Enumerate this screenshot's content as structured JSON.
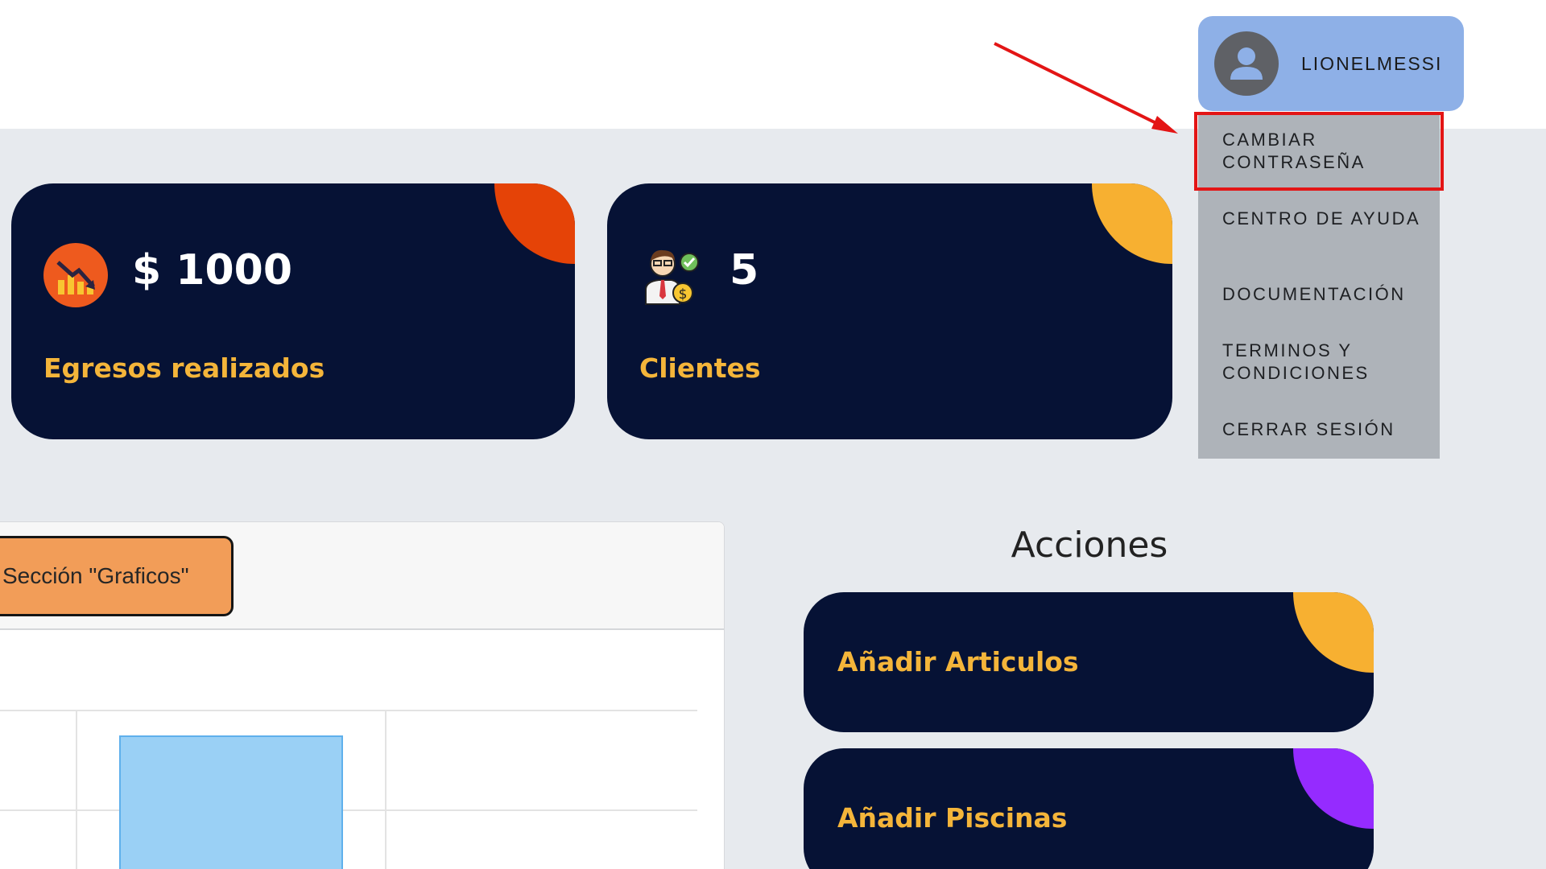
{
  "header": {
    "user_name": "LIONELMESSI"
  },
  "user_menu": {
    "items": [
      {
        "label": "CAMBIAR CONTRASEÑA",
        "highlighted": true
      },
      {
        "label": "CENTRO DE AYUDA"
      },
      {
        "label": "DOCUMENTACIÓN"
      },
      {
        "label": "TERMINOS Y CONDICIONES"
      },
      {
        "label": "CERRAR SESIÓN"
      }
    ]
  },
  "stats": [
    {
      "value": "$ 1000",
      "label": "Egresos realizados",
      "icon": "expenses-chart-icon",
      "accent": "#e54307"
    },
    {
      "value": "5",
      "label": "Clientes",
      "icon": "client-money-icon",
      "accent": "#f7b031"
    }
  ],
  "graphs_section": {
    "button_label": "Sección \"Graficos\"",
    "bar_color": "#9ad0f5"
  },
  "actions": {
    "title": "Acciones",
    "items": [
      {
        "label": "Añadir Articulos",
        "accent": "#f7b031"
      },
      {
        "label": "Añadir Piscinas",
        "accent": "#952bff"
      }
    ]
  },
  "colors": {
    "card_bg": "#061235",
    "label_gold": "#f4b53a",
    "menu_bg": "#aeb3b9",
    "user_chip": "#8eb0e7",
    "highlight_border": "#e31515"
  }
}
